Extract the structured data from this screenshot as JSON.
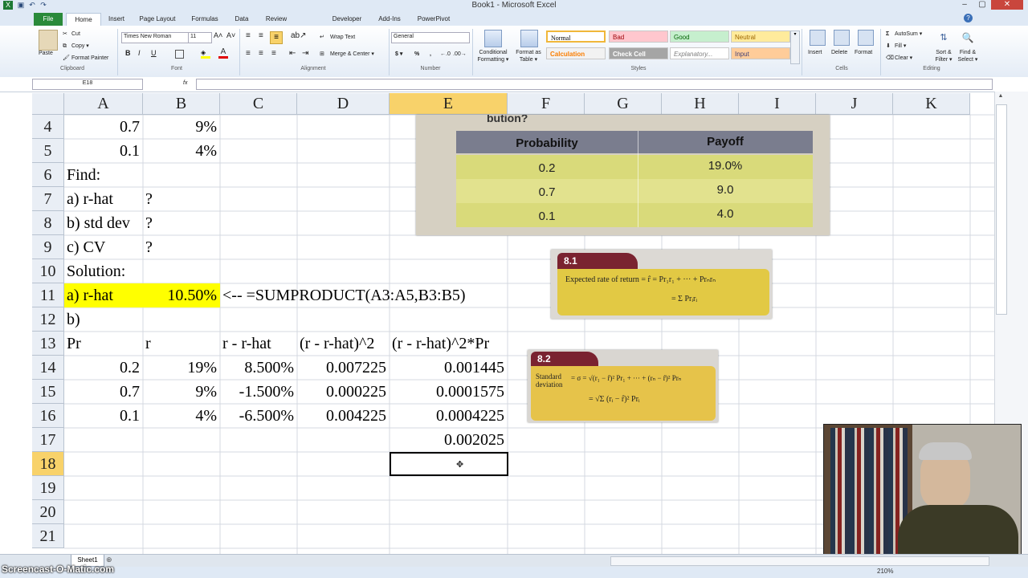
{
  "window": {
    "title": "Book1 - Microsoft Excel",
    "min": "–",
    "max": "▢",
    "close": "✕"
  },
  "tabs": [
    "File",
    "Home",
    "Insert",
    "Page Layout",
    "Formulas",
    "Data",
    "Review",
    "Developer",
    "Add-Ins",
    "PowerPivot"
  ],
  "ribbon": {
    "clipboard": {
      "paste": "Paste",
      "cut": "Cut",
      "copy": "Copy ▾",
      "format_painter": "Format Painter",
      "label": "Clipboard"
    },
    "font": {
      "name": "Times New Roman",
      "size": "11",
      "label": "Font",
      "bold": "B",
      "italic": "I",
      "underline": "U"
    },
    "alignment": {
      "wrap": "Wrap Text",
      "merge": "Merge & Center ▾",
      "label": "Alignment"
    },
    "number": {
      "format": "General",
      "dollar": "$ ▾",
      "percent": "%",
      "comma": ",",
      "label": "Number"
    },
    "styles": {
      "conditional": "Conditional Formatting ▾",
      "format_table": "Format as Table ▾",
      "label": "Styles",
      "items": [
        {
          "name": "Normal",
          "bg": "#ffffff",
          "fg": "#000000"
        },
        {
          "name": "Bad",
          "bg": "#ffc7ce",
          "fg": "#9c0006"
        },
        {
          "name": "Good",
          "bg": "#c6efce",
          "fg": "#006100"
        },
        {
          "name": "Neutral",
          "bg": "#ffeb9c",
          "fg": "#9c6500"
        },
        {
          "name": "Calculation",
          "bg": "#f2f2f2",
          "fg": "#fa7d00"
        },
        {
          "name": "Check Cell",
          "bg": "#a5a5a5",
          "fg": "#ffffff"
        },
        {
          "name": "Explanatory...",
          "bg": "#ffffff",
          "fg": "#7f7f7f"
        },
        {
          "name": "Input",
          "bg": "#ffcc99",
          "fg": "#3f3f76"
        }
      ]
    },
    "cells": {
      "insert": "Insert",
      "delete": "Delete",
      "format": "Format",
      "label": "Cells"
    },
    "editing": {
      "autosum": "AutoSum ▾",
      "fill": "Fill ▾",
      "clear": "Clear ▾",
      "sort": "Sort & Filter ▾",
      "find": "Find & Select ▾",
      "label": "Editing"
    }
  },
  "formula_bar": {
    "name_box": "E18",
    "fx": "fx",
    "value": ""
  },
  "columns": [
    "A",
    "B",
    "C",
    "D",
    "E",
    "F",
    "G",
    "H",
    "I",
    "J",
    "K"
  ],
  "selected_column": "E",
  "rows": [
    "4",
    "5",
    "6",
    "7",
    "8",
    "9",
    "10",
    "11",
    "12",
    "13",
    "14",
    "15",
    "16",
    "17",
    "18",
    "19",
    "20",
    "21"
  ],
  "selected_row": "18",
  "cells": {
    "r4": {
      "A": "0.7",
      "B": "9%"
    },
    "r5": {
      "A": "0.1",
      "B": "4%"
    },
    "r6": {
      "A": "Find:"
    },
    "r7": {
      "A": "a) r-hat",
      "B": "?"
    },
    "r8": {
      "A": "b) std dev",
      "B": "?"
    },
    "r9": {
      "A": "c) CV",
      "B": "?"
    },
    "r10": {
      "A": "Solution:"
    },
    "r11": {
      "A": "a) r-hat",
      "B": "10.50%",
      "C": "<--  =SUMPRODUCT(A3:A5,B3:B5)"
    },
    "r12": {
      "A": "b)"
    },
    "r13": {
      "A": "Pr",
      "B": "r",
      "C": "r - r-hat",
      "D": "(r - r-hat)^2",
      "E": "(r - r-hat)^2*Pr"
    },
    "r14": {
      "A": "0.2",
      "B": "19%",
      "C": "8.500%",
      "D": "0.007225",
      "E": "0.001445"
    },
    "r15": {
      "A": "0.7",
      "B": "9%",
      "C": "-1.500%",
      "D": "0.000225",
      "E": "0.0001575"
    },
    "r16": {
      "A": "0.1",
      "B": "4%",
      "C": "-6.500%",
      "D": "0.004225",
      "E": "0.0004225"
    },
    "r17": {
      "E": "0.002025"
    }
  },
  "highlight_color": "#ffff00",
  "table_image": {
    "heading": "bution?",
    "headers": [
      "Probability",
      "Payoff"
    ],
    "rows": [
      [
        "0.2",
        "19.0%"
      ],
      [
        "0.7",
        "9.0"
      ],
      [
        "0.1",
        "4.0"
      ]
    ]
  },
  "formula_card_1": {
    "tag": "8.1",
    "line1": "Expected rate of return = r̂ = Pr₁r₁ + ··· + Prₙrₙ",
    "line2": "= Σ Prᵢrᵢ"
  },
  "formula_card_2": {
    "tag": "8.2",
    "label": "Standard deviation",
    "line1": "= σ = √(r₁ − r̂)² Pr₁ + ··· + (rₙ − r̂)² Prₙ",
    "line2": "= √Σ (rᵢ − r̂)² Prᵢ"
  },
  "sheet_tab": "Sheet1",
  "watermark": "Screencast-O-Matic.com",
  "zoom": "210%"
}
